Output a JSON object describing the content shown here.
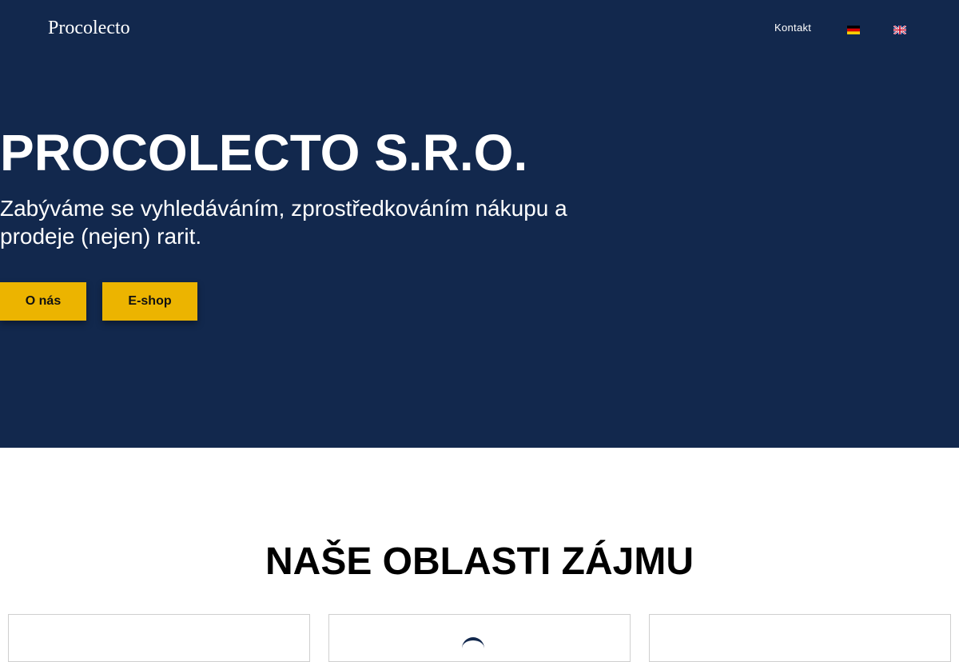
{
  "header": {
    "brand": "Procolecto",
    "nav": {
      "contact_label": "Kontakt"
    },
    "languages": [
      {
        "code": "de",
        "icon": "german-flag-icon"
      },
      {
        "code": "en",
        "icon": "uk-flag-icon"
      }
    ]
  },
  "hero": {
    "title": "PROCOLECTO S.R.O.",
    "subtitle": "Zabýváme se vyhledáváním, zprostředkováním nákupu a prodeje (nejen) rarit.",
    "buttons": {
      "about_label": "O nás",
      "eshop_label": "E-shop"
    }
  },
  "interests": {
    "title": "NAŠE OBLASTI ZÁJMU"
  },
  "colors": {
    "hero_background": "#12284d",
    "accent": "#ecb400",
    "text_light": "#ffffff",
    "text_dark": "#000000"
  }
}
